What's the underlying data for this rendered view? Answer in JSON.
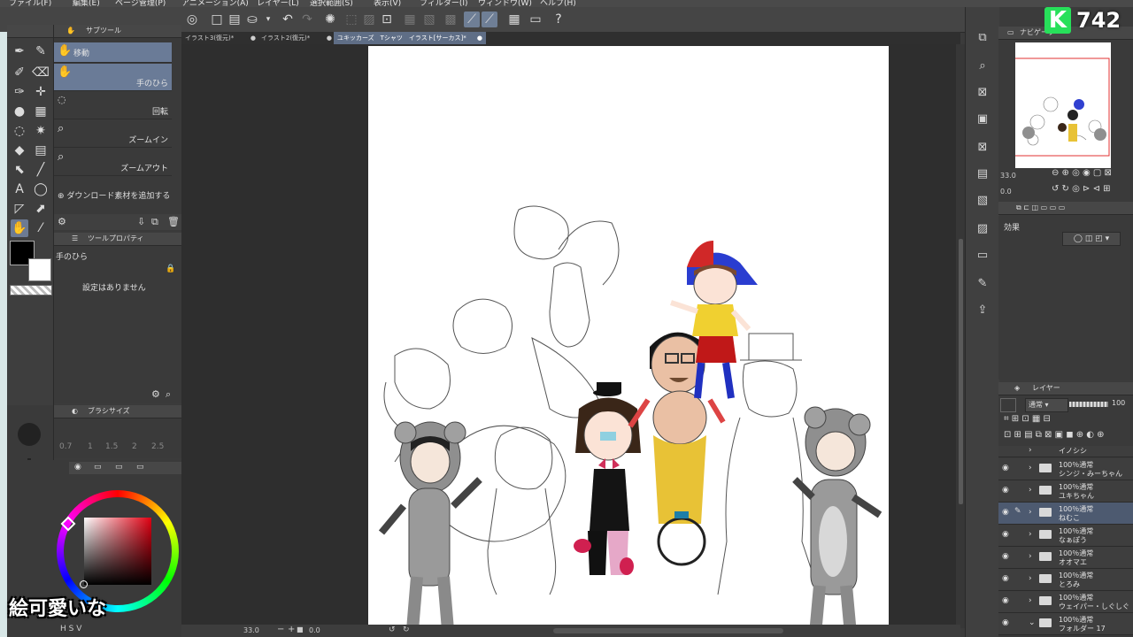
{
  "menu": [
    "ファイル(F)",
    "編集(E)",
    "ページ管理(P)",
    "アニメーション(A)",
    "レイヤー(L)",
    "選択範囲(S)",
    "表示(V)",
    "フィルター(I)",
    "ウィンドウ(W)",
    "ヘルプ(H)"
  ],
  "tabs": [
    "イラスト3(復元)*",
    "イラスト2(復元)*",
    "ユキッカーズ　Tシャツ　イラスト[サーカス]*"
  ],
  "subtool": {
    "header": "サブツール",
    "items": [
      "移動",
      "手のひら",
      "回転",
      "ズームイン",
      "ズームアウト"
    ],
    "add_material": "ダウンロード素材を追加する"
  },
  "tool_property": {
    "header": "ツールプロパティ",
    "tool_name": "手のひら",
    "empty_message": "設定はありません"
  },
  "brush_size": {
    "header": "ブラシサイズ",
    "values": [
      "0.7",
      "1",
      "1.5",
      "2",
      "2.5"
    ]
  },
  "navigator": {
    "header": "ナビゲーター",
    "zoom": "33.0",
    "angle": "0.0"
  },
  "effect": {
    "label": "効果"
  },
  "layers": {
    "header": "レイヤー",
    "blend_mode": "通常",
    "opacity": "100",
    "items": [
      {
        "line1": "イノシシ",
        "line2": ""
      },
      {
        "line1": "100％通常",
        "line2": "シンジ・みーちゃん"
      },
      {
        "line1": "100％通常",
        "line2": "ユキちゃん"
      },
      {
        "line1": "100％通常",
        "line2": "ねむこ",
        "selected": true
      },
      {
        "line1": "100％通常",
        "line2": "なぁぽう"
      },
      {
        "line1": "100％通常",
        "line2": "オオマエ"
      },
      {
        "line1": "100％通常",
        "line2": "とろみ"
      },
      {
        "line1": "100％通常",
        "line2": "ウェイパー・しぐしぐ"
      },
      {
        "line1": "100％通常",
        "line2": "フォルダー 17"
      }
    ]
  },
  "status": {
    "zoom": "33.0",
    "angle": "0.0"
  },
  "overlay": {
    "logo_letter": "K",
    "logo_number": "742",
    "caption": "絵可愛いな"
  },
  "colors": {
    "accent": "#6c7a93",
    "logo_green": "#27e05a"
  }
}
